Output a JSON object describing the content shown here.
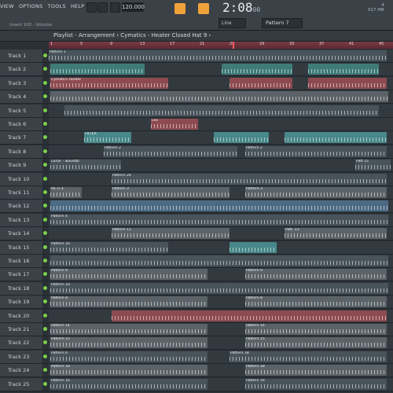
{
  "menu": [
    "VIEW",
    "OPTIONS",
    "TOOLS",
    "HELP"
  ],
  "transport": {
    "tempo": "120.000",
    "time": "2:08",
    "time_small": "00",
    "pattern": "Pattern 7",
    "snap": "Line"
  },
  "hint": "Insert 100 - Volume",
  "cpu": {
    "mem": "917 MB",
    "val": "4"
  },
  "window_title": "Playlist - Arrangement › Cymatics - Heater Closed Hat 9 ›",
  "ruler_ticks": [
    "1",
    "5",
    "9",
    "13",
    "17",
    "21",
    "25",
    "29",
    "33",
    "37",
    "41",
    "45"
  ],
  "tracks": [
    {
      "name": "Track 1",
      "clips": [
        {
          "label": "Pattern 1",
          "color": "c-dark"
        }
      ]
    },
    {
      "name": "Track 2",
      "clips": [
        {
          "label": "",
          "color": "c-teal"
        },
        {
          "label": "",
          "color": "c-teal"
        },
        {
          "label": "",
          "color": "c-teal"
        }
      ]
    },
    {
      "name": "Track 3",
      "clips": [
        {
          "label": "Cymatics Heater",
          "color": "c-red"
        },
        {
          "label": "",
          "color": "c-red"
        },
        {
          "label": "",
          "color": "c-red"
        }
      ]
    },
    {
      "name": "Track 4",
      "clips": [
        {
          "label": "",
          "color": "c-grey"
        }
      ]
    },
    {
      "name": "Track 5",
      "clips": [
        {
          "label": "",
          "color": "c-dark"
        }
      ]
    },
    {
      "name": "Track 6",
      "clips": [
        {
          "label": "Lex",
          "color": "c-red"
        }
      ]
    },
    {
      "name": "Track 7",
      "clips": [
        {
          "label": "FILTER",
          "color": "c-teal2"
        },
        {
          "label": "",
          "color": "c-teal2"
        },
        {
          "label": "",
          "color": "c-teal2"
        }
      ]
    },
    {
      "name": "Track 8",
      "clips": [
        {
          "label": "Pattern 2",
          "color": "c-dark"
        },
        {
          "label": "Pattern 2",
          "color": "c-dark"
        }
      ]
    },
    {
      "name": "Track 9",
      "clips": [
        {
          "label": "Lunar - wavetbl",
          "color": "c-dark"
        },
        {
          "label": "Patt 21",
          "color": "c-dark"
        }
      ]
    },
    {
      "name": "Track 10",
      "clips": [
        {
          "label": "Pattern 24",
          "color": "c-dark"
        }
      ]
    },
    {
      "name": "Track 11",
      "clips": [
        {
          "label": "Pa..n 3",
          "color": "c-grey"
        },
        {
          "label": "Pattern 3",
          "color": "c-grey"
        },
        {
          "label": "Pattern 3",
          "color": "c-grey"
        }
      ]
    },
    {
      "name": "Track 12",
      "clips": [
        {
          "label": "",
          "color": "c-blue"
        }
      ]
    },
    {
      "name": "Track 13",
      "clips": [
        {
          "label": "Pattern 4",
          "color": "c-dark"
        }
      ]
    },
    {
      "name": "Track 14",
      "clips": [
        {
          "label": "Pattern 11",
          "color": "c-grey"
        },
        {
          "label": "Patt..11",
          "color": "c-grey"
        }
      ]
    },
    {
      "name": "Track 15",
      "clips": [
        {
          "label": "Pattern 16",
          "color": "c-dark"
        },
        {
          "label": "",
          "color": "c-teal2"
        }
      ]
    },
    {
      "name": "Track 16",
      "clips": [
        {
          "label": "",
          "color": "c-dark"
        }
      ]
    },
    {
      "name": "Track 17",
      "clips": [
        {
          "label": "Pattern 9",
          "color": "c-grey"
        },
        {
          "label": "Pattern 9",
          "color": "c-grey"
        }
      ]
    },
    {
      "name": "Track 18",
      "clips": [
        {
          "label": "Pattern 10",
          "color": "c-dark"
        }
      ]
    },
    {
      "name": "Track 19",
      "clips": [
        {
          "label": "Pattern 8",
          "color": "c-grey"
        },
        {
          "label": "Pattern 8",
          "color": "c-grey"
        }
      ]
    },
    {
      "name": "Track 20",
      "clips": [
        {
          "label": "",
          "color": "c-red"
        }
      ]
    },
    {
      "name": "Track 21",
      "clips": [
        {
          "label": "Pattern 14",
          "color": "c-grey"
        },
        {
          "label": "Pattern 14",
          "color": "c-grey"
        }
      ]
    },
    {
      "name": "Track 22",
      "clips": [
        {
          "label": "Pattern 15",
          "color": "c-grey"
        },
        {
          "label": "Pattern 15",
          "color": "c-grey"
        }
      ]
    },
    {
      "name": "Track 23",
      "clips": [
        {
          "label": "Pattern 6",
          "color": "c-dark"
        },
        {
          "label": "Pattern 18",
          "color": "c-dark"
        }
      ]
    },
    {
      "name": "Track 24",
      "clips": [
        {
          "label": "Pattern 18",
          "color": "c-grey"
        },
        {
          "label": "Pattern 18",
          "color": "c-grey"
        }
      ]
    },
    {
      "name": "Track 25",
      "clips": [
        {
          "label": "Pattern 16",
          "color": "c-dark"
        },
        {
          "label": "Pattern 16",
          "color": "c-dark"
        }
      ]
    }
  ]
}
